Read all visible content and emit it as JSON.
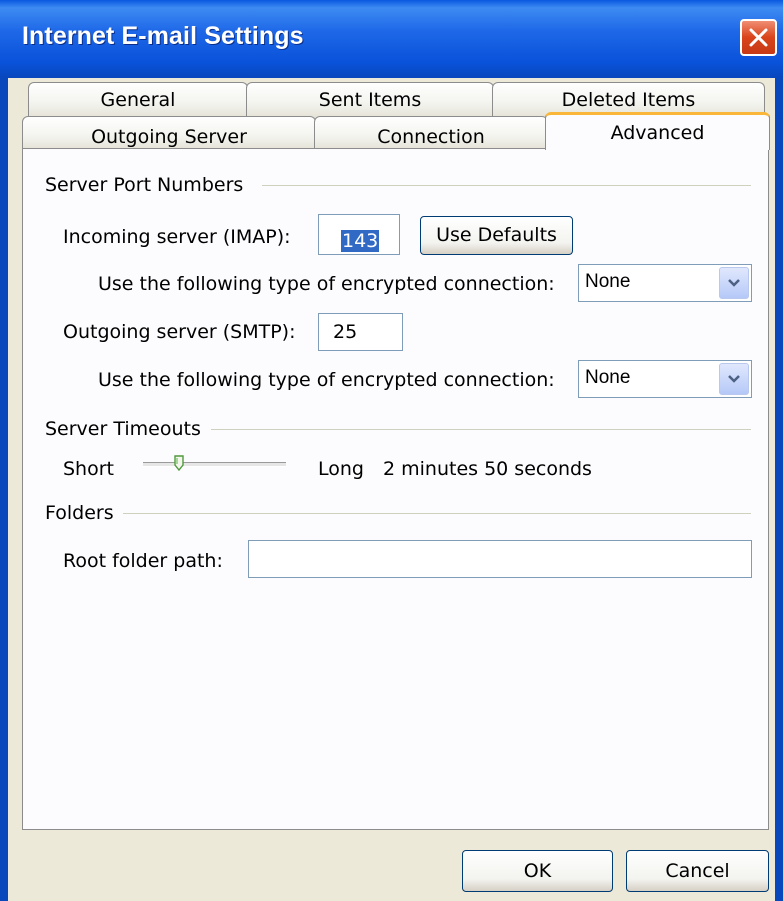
{
  "window": {
    "title": "Internet E-mail Settings"
  },
  "tabs": {
    "row1": [
      "General",
      "Sent Items",
      "Deleted Items"
    ],
    "row2": [
      "Outgoing Server",
      "Connection",
      "Advanced"
    ],
    "active": "Advanced"
  },
  "server_ports": {
    "section_label": "Server Port Numbers",
    "incoming_label": "Incoming server (IMAP):",
    "incoming_value": "143",
    "use_defaults_label": "Use Defaults",
    "incoming_encryption_label": "Use the following type of encrypted connection:",
    "incoming_encryption_value": "None",
    "outgoing_label": "Outgoing server (SMTP):",
    "outgoing_value": "25",
    "outgoing_encryption_label": "Use the following type of encrypted connection:",
    "outgoing_encryption_value": "None"
  },
  "timeouts": {
    "section_label": "Server Timeouts",
    "short_label": "Short",
    "long_label": "Long",
    "value_text": "2 minutes 50 seconds",
    "slider_fraction": 0.25
  },
  "folders": {
    "section_label": "Folders",
    "root_path_label": "Root folder path:",
    "root_path_value": ""
  },
  "buttons": {
    "ok": "OK",
    "cancel": "Cancel"
  },
  "colors": {
    "titlebar": "#0A58E0",
    "active_tab_accent": "#F9B639",
    "dialog_bg": "#ECE9D8",
    "selection": "#316AC5"
  }
}
